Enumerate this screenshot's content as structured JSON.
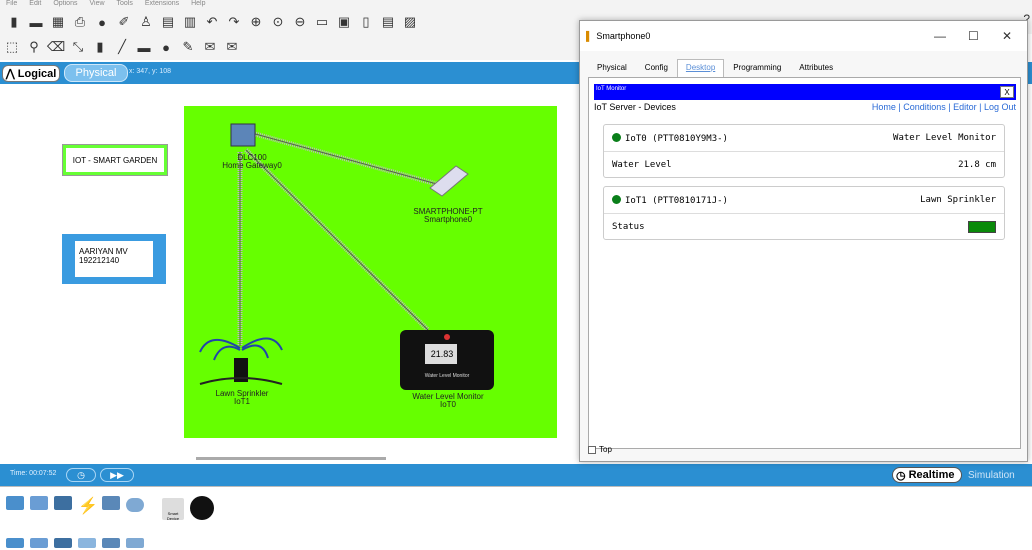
{
  "menubar": {
    "items": [
      "File",
      "Edit",
      "Options",
      "View",
      "Tools",
      "Extensions",
      "Help"
    ]
  },
  "toolbar": {
    "icons1": [
      "new-icon",
      "open-icon",
      "save-icon",
      "print-icon",
      "info-icon",
      "wizard-icon",
      "user-icon",
      "copy-icon",
      "paste-icon",
      "undo-icon",
      "redo-icon",
      "zoom-in-icon",
      "zoom-reset-icon",
      "zoom-out-icon",
      "rect-icon",
      "grid-icon",
      "device-icon",
      "palette-icon",
      "image-icon"
    ],
    "icons2": [
      "select-icon",
      "inspect-icon",
      "delete-icon",
      "resize-icon",
      "note-icon",
      "line-icon",
      "rect-draw-icon",
      "ellipse-icon",
      "pencil-icon",
      "mail-icon",
      "open-mail-icon"
    ],
    "help": "?"
  },
  "viewbar": {
    "logical": "Logical",
    "physical": "Physical",
    "coords": "x: 347, y: 108"
  },
  "workspace": {
    "garden_label": "IOT - SMART GARDEN",
    "name_line1": "AARIYAN MV",
    "name_line2": "192212140",
    "gateway_line1": "DLC100",
    "gateway_line2": "Home Gateway0",
    "phone_line1": "SMARTPHONE-PT",
    "phone_line2": "Smartphone0",
    "sprinkler_line1": "Lawn Sprinkler",
    "sprinkler_line2": "IoT1",
    "monitor_value": "21.83",
    "monitor_sub": "Water Level Monitor",
    "monitor_line1": "Water Level Monitor",
    "monitor_line2": "IoT0"
  },
  "timebar": {
    "time": "Time: 00:07:52",
    "realtime": "Realtime",
    "simulation": "Simulation"
  },
  "palette": {
    "smart_device": "Smart Device"
  },
  "dialog": {
    "title": "Smartphone0",
    "tabs": [
      "Physical",
      "Config",
      "Desktop",
      "Programming",
      "Attributes"
    ],
    "active_tab": "Desktop",
    "iot_header": "IoT Monitor",
    "iot_close": "X",
    "iot_sub": "IoT Server - Devices",
    "nav": "Home | Conditions | Editor | Log Out",
    "devices": [
      {
        "name": "IoT0 (PTT0810Y9M3-)",
        "type": "Water Level Monitor",
        "prop_label": "Water Level",
        "prop_value": "21.8 cm"
      },
      {
        "name": "IoT1 (PTT0810171J-)",
        "type": "Lawn Sprinkler",
        "prop_label": "Status",
        "prop_value": ""
      }
    ],
    "top_label": "Top",
    "status_color": "#0a8a0a"
  }
}
